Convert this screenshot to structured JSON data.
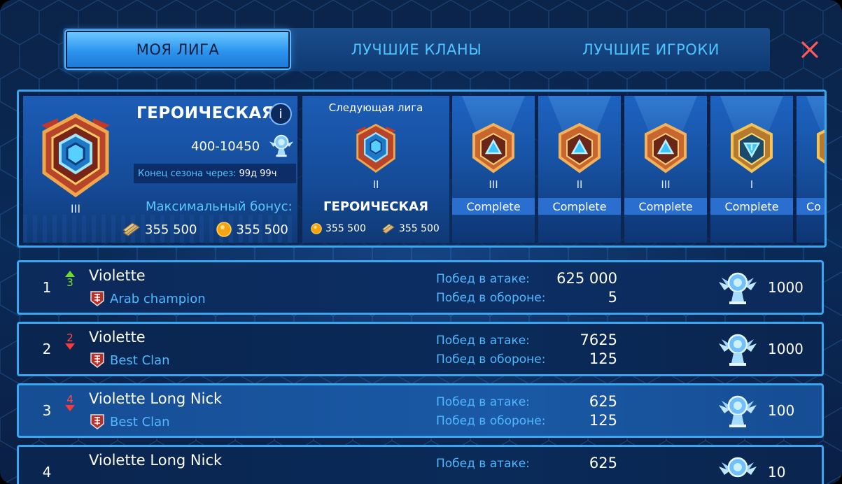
{
  "tabs": [
    {
      "label": "МОЯ ЛИГА",
      "active": true
    },
    {
      "label": "ЛУЧШИЕ КЛАНЫ",
      "active": false
    },
    {
      "label": "ЛУЧШИЕ ИГРОКИ",
      "active": false
    }
  ],
  "colors": {
    "accent": "#3aa6ef",
    "label_blue": "#4fb8ff",
    "up_green": "#7ce22e",
    "down_red": "#ff4a4a"
  },
  "icons": {
    "close": "close-icon",
    "info": "info-icon",
    "cup": "trophy-icon",
    "wood": "wood-resource-icon",
    "coin": "gold-coin-icon",
    "clan": "clan-emblem-icon"
  },
  "current_league": {
    "name": "ГЕРОИЧЕСКАЯ",
    "info_label": "i",
    "tier": "III",
    "range": "400-10450",
    "season_label": "Конец сезона через:",
    "season_value": "99д 99ч",
    "max_bonus_label": "Максимальный бонус:",
    "bonus_wood": "355 500",
    "bonus_gold": "355 500"
  },
  "next_league": {
    "title": "Следующая лига",
    "tier": "II",
    "name": "ГЕРОИЧЕСКАЯ",
    "reward_gold": "355 500",
    "reward_wood": "355 500"
  },
  "tiers": [
    {
      "tier": "III",
      "status": "Complete"
    },
    {
      "tier": "II",
      "status": "Complete"
    },
    {
      "tier": "III",
      "status": "Complete"
    },
    {
      "tier": "I",
      "status": "Complete"
    },
    {
      "tier": "",
      "status": "Co"
    }
  ],
  "stat_labels": {
    "attack": "Побед в атаке:",
    "defense": "Побед в обороне:"
  },
  "players": [
    {
      "rank": "1",
      "change": "3",
      "direction": "up",
      "name": "Violette",
      "clan": "Arab champion",
      "attack": "625 000",
      "defense": "5",
      "points": "1000"
    },
    {
      "rank": "2",
      "change": "2",
      "direction": "down",
      "name": "Violette",
      "clan": "Best Clan",
      "attack": "7625",
      "defense": "125",
      "points": "1000"
    },
    {
      "rank": "3",
      "change": "4",
      "direction": "down",
      "name": "Violette Long Nick",
      "clan": "Best Clan",
      "attack": "625",
      "defense": "125",
      "points": "100"
    },
    {
      "rank": "4",
      "change": "",
      "direction": "",
      "name": "Violette Long Nick",
      "clan": "",
      "attack": "625",
      "defense": "",
      "points": "10"
    }
  ]
}
